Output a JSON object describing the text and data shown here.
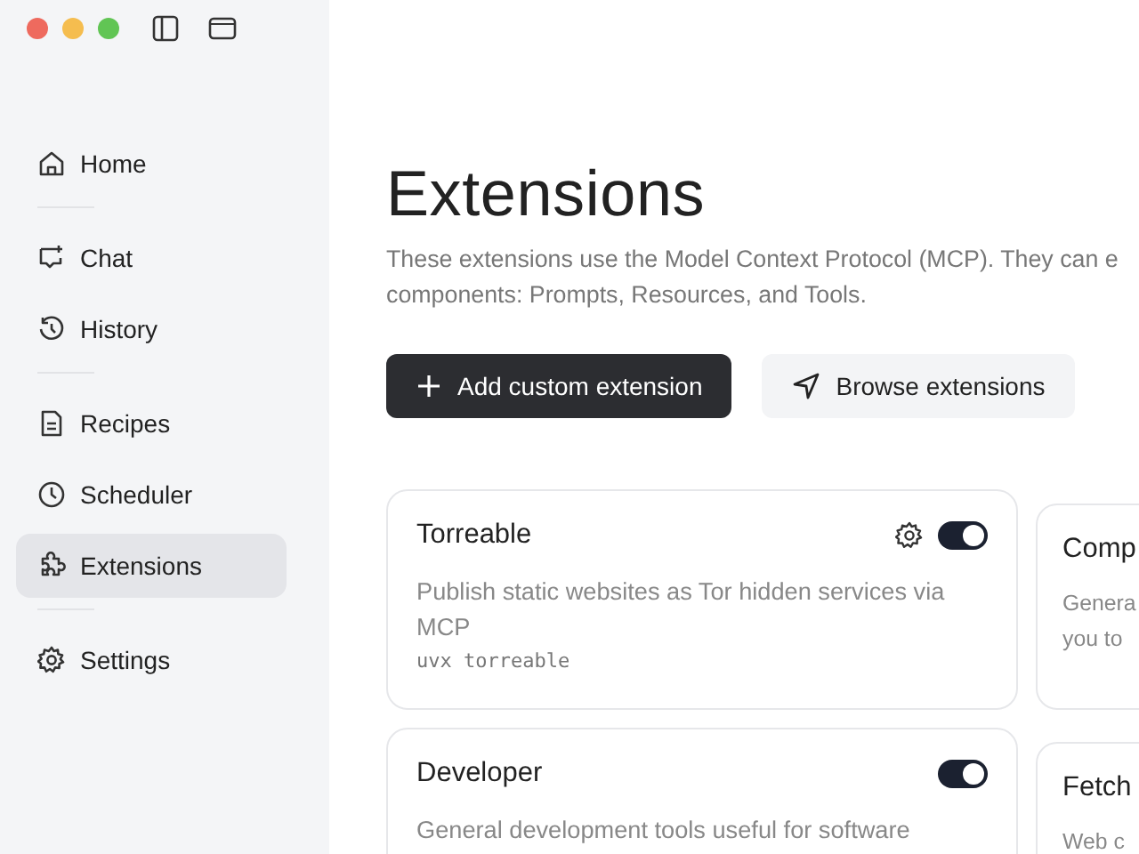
{
  "sidebar": {
    "groups": [
      [
        {
          "label": "Home",
          "kind": "home",
          "selected": false
        }
      ],
      [
        {
          "label": "Chat",
          "kind": "chat",
          "selected": false
        },
        {
          "label": "History",
          "kind": "history",
          "selected": false
        }
      ],
      [
        {
          "label": "Recipes",
          "kind": "recipes",
          "selected": false
        },
        {
          "label": "Scheduler",
          "kind": "scheduler",
          "selected": false
        },
        {
          "label": "Extensions",
          "kind": "extensions",
          "selected": true
        }
      ],
      [
        {
          "label": "Settings",
          "kind": "settings",
          "selected": false
        }
      ]
    ]
  },
  "page": {
    "title": "Extensions",
    "description": [
      "These extensions use the Model Context Protocol (MCP). They can e",
      "components: Prompts, Resources, and Tools."
    ],
    "buttons": [
      {
        "label": "Add custom extension",
        "kind": "primary"
      },
      {
        "label": "Browse extensions",
        "kind": "secondary"
      }
    ]
  },
  "cards": [
    {
      "name": "Torreable",
      "description": "Publish static websites as Tor hidden services via MCP",
      "command": "uvx torreable",
      "settings": true,
      "enabled": true
    },
    {
      "name": "Comp",
      "description": "Genera\nyou to"
    },
    {
      "name": "Developer",
      "description": "General development tools useful for software",
      "enabled": true
    },
    {
      "name": "Fetch",
      "description": "Web c"
    }
  ]
}
